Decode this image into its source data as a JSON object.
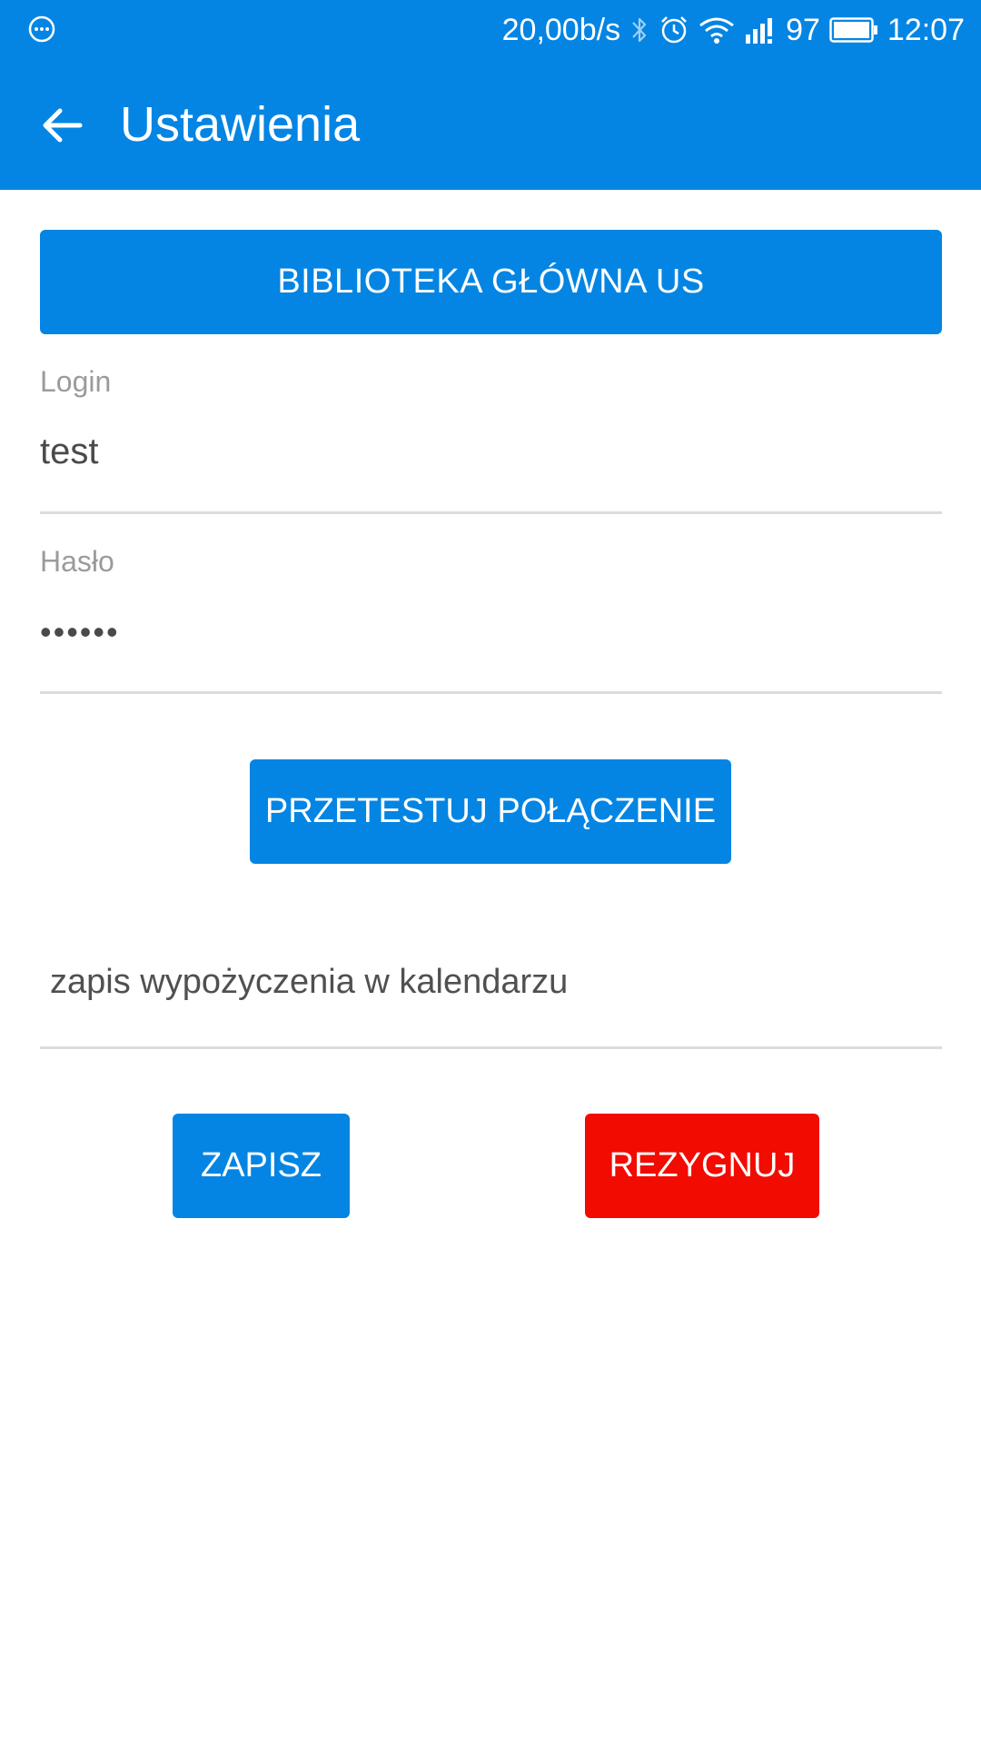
{
  "status_bar": {
    "network_speed": "20,00b/s",
    "battery_level": "97",
    "time": "12:07",
    "icons": [
      "chat-bubble-icon",
      "bluetooth-icon",
      "alarm-icon",
      "wifi-icon",
      "signal-icon",
      "battery-icon"
    ]
  },
  "app_bar": {
    "title": "Ustawienia",
    "back_icon": "arrow-left-icon"
  },
  "library_button": {
    "label": "BIBLIOTEKA GŁÓWNA US"
  },
  "login_field": {
    "label": "Login",
    "value": "test"
  },
  "password_field": {
    "label": "Hasło",
    "value": "••••••"
  },
  "test_button": {
    "label": "PRZETESTUJ POŁĄCZENIE"
  },
  "calendar_option": {
    "label": "zapis wypożyczenia w kalendarzu"
  },
  "actions": {
    "save_label": "ZAPISZ",
    "cancel_label": "REZYGNUJ"
  },
  "colors": {
    "primary": "#0485e3",
    "danger": "#f20b00"
  }
}
